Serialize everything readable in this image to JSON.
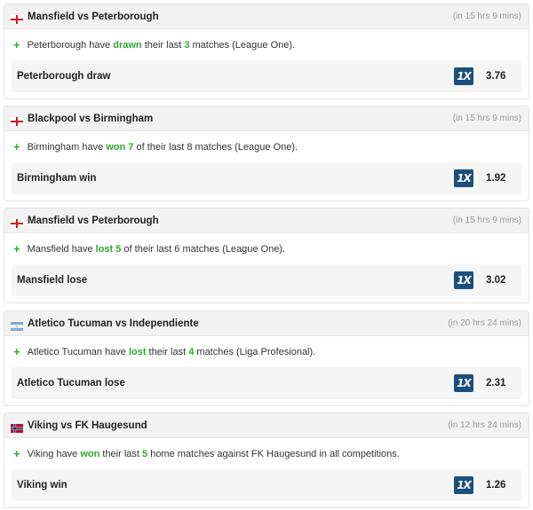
{
  "colors": {
    "highlight": "#2fa82f",
    "bookmaker": "#1d4f7c"
  },
  "cards": [
    {
      "flag": "england",
      "title": "Mansfield vs Peterborough",
      "time": "(in 15 hrs 9 mins)",
      "stat": [
        "Peterborough have ",
        "drawn",
        " their last ",
        "3",
        " matches (League One)."
      ],
      "bet_label": "Peterborough draw",
      "bookmaker_icon": "1xbet-logo",
      "bookmaker_text": "1X",
      "odds": "3.76"
    },
    {
      "flag": "england",
      "title": "Blackpool vs Birmingham",
      "time": "(in 15 hrs 9 mins)",
      "stat": [
        "Birmingham have ",
        "won 7",
        " of their last 8 matches (League One).",
        "",
        ""
      ],
      "bet_label": "Birmingham win",
      "bookmaker_icon": "1xbet-logo",
      "bookmaker_text": "1X",
      "odds": "1.92"
    },
    {
      "flag": "england",
      "title": "Mansfield vs Peterborough",
      "time": "(in 15 hrs 9 mins)",
      "stat": [
        "Mansfield have ",
        "lost 5",
        " of their last 6 matches (League One).",
        "",
        ""
      ],
      "bet_label": "Mansfield lose",
      "bookmaker_icon": "1xbet-logo",
      "bookmaker_text": "1X",
      "odds": "3.02"
    },
    {
      "flag": "argentina",
      "title": "Atletico Tucuman vs Independiente",
      "time": "(in 20 hrs 24 mins)",
      "stat": [
        "Atletico Tucuman have ",
        "lost",
        " their last ",
        "4",
        " matches (Liga Profesional)."
      ],
      "bet_label": "Atletico Tucuman lose",
      "bookmaker_icon": "1xbet-logo",
      "bookmaker_text": "1X",
      "odds": "2.31"
    },
    {
      "flag": "norway",
      "title": "Viking vs FK Haugesund",
      "time": "(in 12 hrs 24 mins)",
      "stat": [
        "Viking have ",
        "won",
        " their last ",
        "5",
        " home matches against FK Haugesund in all competitions."
      ],
      "bet_label": "Viking win",
      "bookmaker_icon": "1xbet-logo",
      "bookmaker_text": "1X",
      "odds": "1.26"
    }
  ]
}
